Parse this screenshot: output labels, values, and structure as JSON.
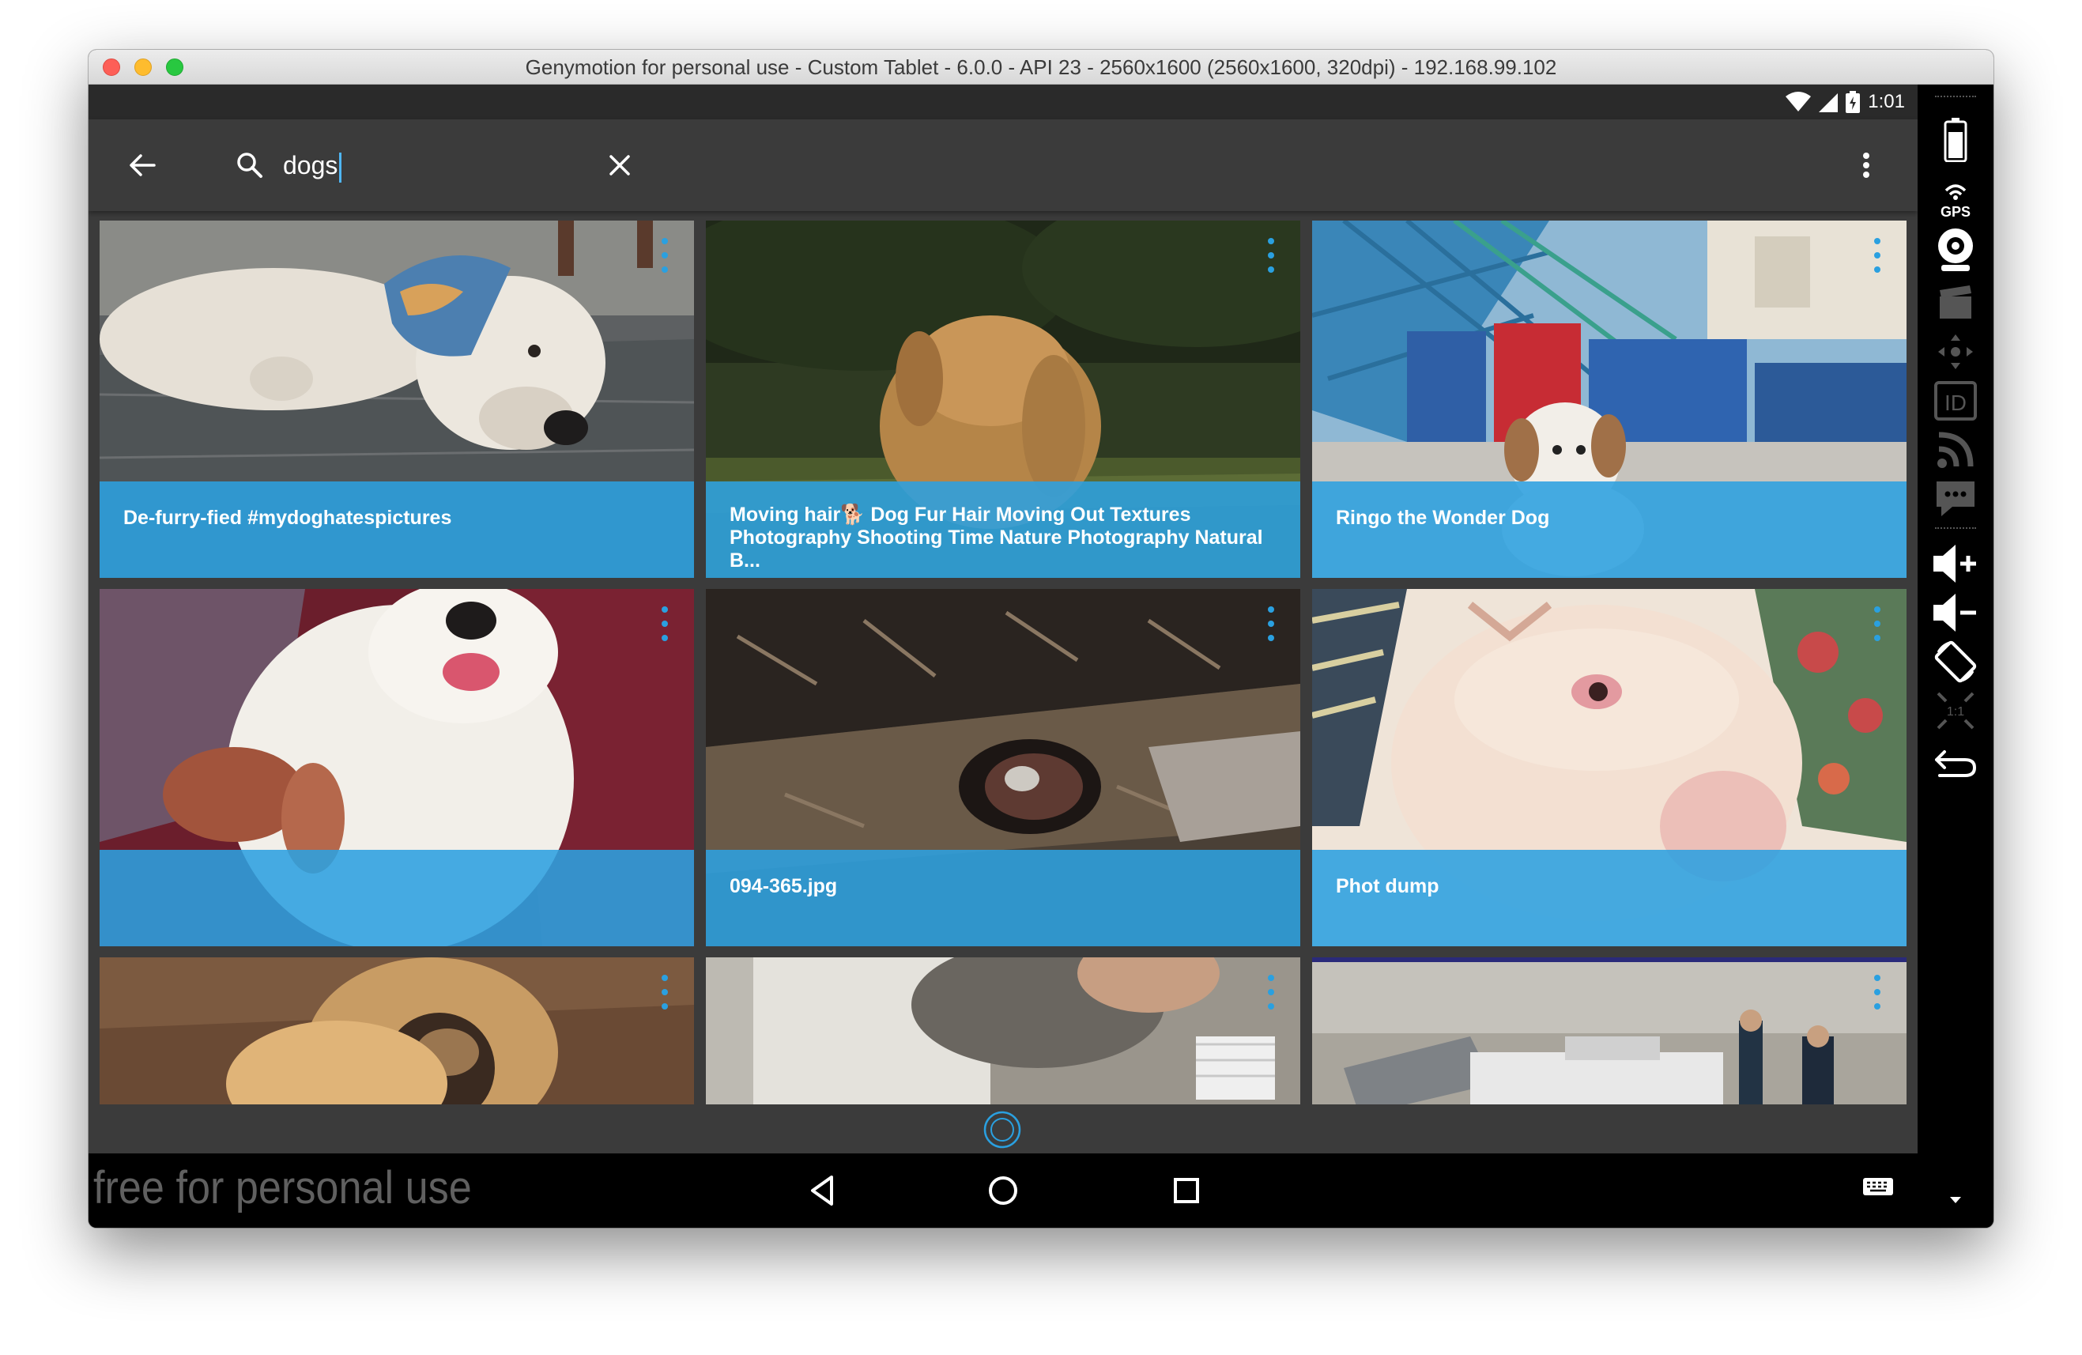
{
  "window": {
    "title": "Genymotion for personal use - Custom Tablet - 6.0.0 - API 23 - 2560x1600 (2560x1600, 320dpi) - 192.168.99.102"
  },
  "statusbar": {
    "time": "1:01",
    "icons": [
      "wifi-icon",
      "signal-icon",
      "battery-charging-icon"
    ]
  },
  "toolbar": {
    "search_query": "dogs",
    "icons": [
      "back-arrow-icon",
      "search-icon",
      "clear-icon",
      "overflow-menu-icon"
    ]
  },
  "results": [
    {
      "caption_lines": [
        "De-furry-fied #mydoghatespictures"
      ]
    },
    {
      "caption_lines": [
        "Moving hair🐕 Dog Fur Hair Moving Out Textures",
        "Photography Shooting Time Nature Photography Natural B..."
      ]
    },
    {
      "caption_lines": [
        "Ringo the Wonder Dog"
      ]
    },
    {
      "caption_lines": [
        ""
      ]
    },
    {
      "caption_lines": [
        "094-365.jpg"
      ]
    },
    {
      "caption_lines": [
        "Phot dump"
      ]
    }
  ],
  "navbar": {
    "watermark": "free for personal use",
    "icons": [
      "nav-back-icon",
      "nav-home-icon",
      "nav-recents-icon",
      "keyboard-icon"
    ]
  },
  "sidebar": {
    "tools": [
      "battery-icon",
      "gps-icon",
      "webcam-icon",
      "capture-icon",
      "dpad-icon",
      "device-id-icon",
      "network-icon",
      "sms-icon",
      "volume-up-icon",
      "volume-down-icon",
      "rotate-icon",
      "pixel-perfect-icon",
      "android-back-icon"
    ]
  },
  "colors": {
    "accent": "#2aa0e0",
    "toolbar": "#3b3b3b",
    "navbar": "#000000"
  }
}
